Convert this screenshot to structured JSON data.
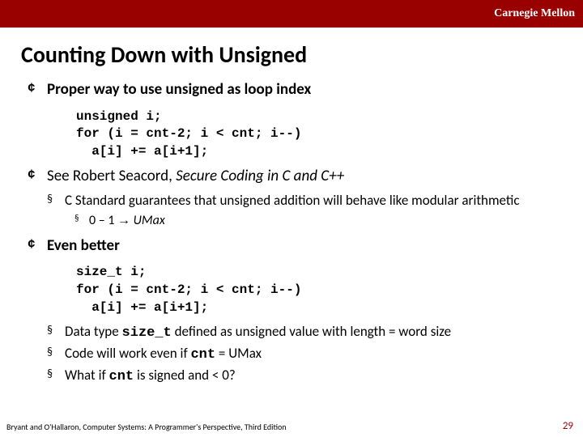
{
  "brand": "Carnegie Mellon",
  "title": "Counting Down with Unsigned",
  "b1_1": "Proper way to use unsigned as loop index",
  "code1": "unsigned i;\nfor (i = cnt-2; i < cnt; i--)\n  a[i] += a[i+1];",
  "b1_2a": "See Robert Seacord, ",
  "b1_2b": "Secure Coding in C and C++",
  "b2_1": "C Standard guarantees that unsigned addition will behave like modular arithmetic",
  "b3_1a": "0 – 1 ",
  "b3_1arrow": "→",
  "b3_1b": " UMax",
  "b1_3": "Even better",
  "code2": "size_t i;\nfor (i = cnt-2; i < cnt; i--)\n  a[i] += a[i+1];",
  "b2_2a": "Data type ",
  "b2_2b": "size_t",
  "b2_2c": " defined as unsigned value with length = word size",
  "b2_3a": "Code will work even if ",
  "b2_3b": "cnt",
  "b2_3c": " = UMax",
  "b2_4a": "What if ",
  "b2_4b": "cnt",
  "b2_4c": " is signed and < 0?",
  "footer": "Bryant and O'Hallaron, Computer Systems: A Programmer's Perspective, Third Edition",
  "pagenum": "29",
  "bul1": "¢",
  "bul2": "§",
  "bul3": "§"
}
